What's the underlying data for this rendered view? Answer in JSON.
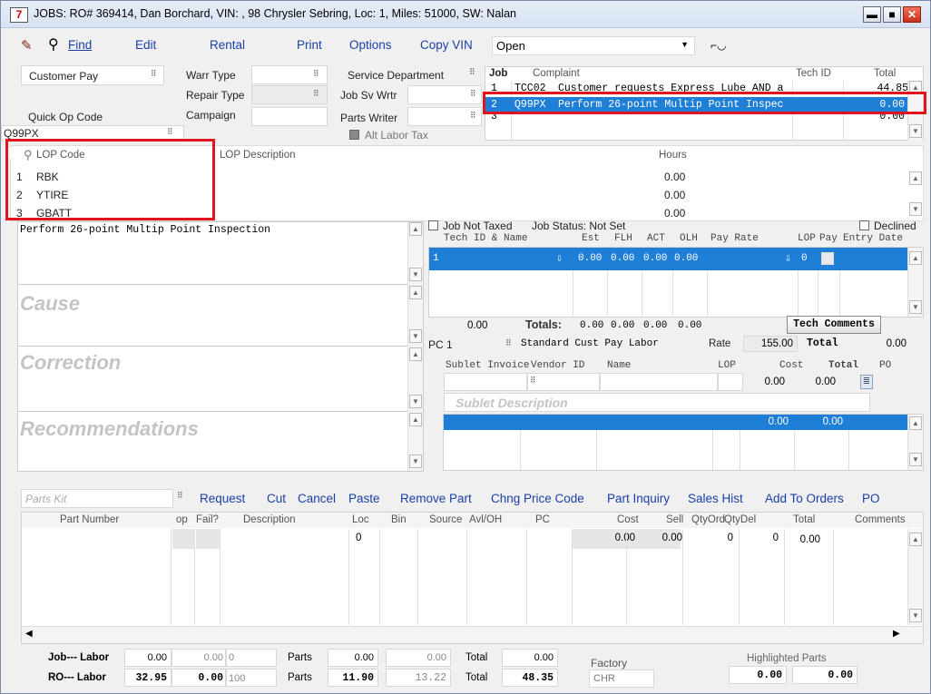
{
  "window": {
    "title": "JOBS: RO# 369414, Dan Borchard, VIN: , 98 Chrysler Sebring, Loc: 1, Miles: 51000, SW: Nalan",
    "icon_label": "7",
    "min": "▬",
    "max": "■",
    "close": "✕"
  },
  "toolbar": {
    "find": "Find",
    "edit": "Edit",
    "rental": "Rental",
    "print": "Print",
    "options": "Options",
    "copy_vin": "Copy VIN",
    "status_value": "Open"
  },
  "header": {
    "pay_type": "Customer Pay",
    "warr_type": "Warr Type",
    "repair_type": "Repair Type",
    "campaign": "Campaign",
    "service_department": "Service Department",
    "job_sv_wrtr": "Job Sv Wrtr",
    "parts_writer": "Parts Writer",
    "alt_labor_tax": "Alt Labor Tax",
    "quick_op_code_label": "Quick Op Code",
    "quick_op_code_value": "Q99PX"
  },
  "jobs": {
    "col_job": "Job",
    "col_complaint": "Complaint",
    "col_tech": "Tech ID",
    "col_total": "Total",
    "rows": [
      {
        "num": "1",
        "code": "TCC02",
        "complaint": "Customer requests Express Lube AND a",
        "total": "44.85"
      },
      {
        "num": "2",
        "code": "Q99PX",
        "complaint": "Perform 26-point Multip Point Inspec",
        "total": "0.00"
      },
      {
        "num": "3",
        "code": "",
        "complaint": "",
        "total": "0.00"
      }
    ]
  },
  "lop": {
    "col_code": "LOP Code",
    "col_desc": "LOP Description",
    "col_hours": "Hours",
    "rows": [
      {
        "num": "1",
        "code": "RBK",
        "hours": "0.00"
      },
      {
        "num": "2",
        "code": "YTIRE",
        "hours": "0.00"
      },
      {
        "num": "3",
        "code": "GBATT",
        "hours": "0.00"
      }
    ]
  },
  "story": {
    "complaint_text": "Perform 26-point Multip Point Inspection",
    "cause": "Cause",
    "correction": "Correction",
    "recommendations": "Recommendations"
  },
  "tech": {
    "job_not_taxed": "Job Not Taxed",
    "job_status": "Job Status: Not Set",
    "declined": "Declined",
    "col_tech": "Tech ID & Name",
    "col_est": "Est",
    "col_flh": "FLH",
    "col_act": "ACT",
    "col_olh": "OLH",
    "col_payrate": "Pay Rate",
    "col_lop": "LOP",
    "col_pay": "Pay",
    "col_entry": "Entry Date",
    "row": {
      "num": "1",
      "est": "0.00",
      "flh": "0.00",
      "act": "0.00",
      "olh": "0.00",
      "lop": "0"
    },
    "totals_left": "0.00",
    "totals_label": "Totals:",
    "t_est": "0.00",
    "t_flh": "0.00",
    "t_act": "0.00",
    "t_olh": "0.00",
    "tech_comments": "Tech Comments",
    "pc_label": "PC 1",
    "pc_desc": "Standard Cust Pay Labor",
    "rate_label": "Rate",
    "rate_value": "155.00",
    "total_label": "Total",
    "total_value": "0.00"
  },
  "sublet": {
    "col_invoice": "Sublet Invoice",
    "col_vendor": "Vendor ID",
    "col_name": "Name",
    "col_lop": "LOP",
    "col_cost": "Cost",
    "col_total": "Total",
    "col_po": "PO",
    "cost": "0.00",
    "total": "0.00",
    "description": "Sublet Description",
    "row_cost": "0.00",
    "row_total": "0.00"
  },
  "parts": {
    "kit_placeholder": "Parts Kit",
    "actions": [
      "Request",
      "Cut",
      "Cancel",
      "Paste",
      "Remove Part",
      "Chng Price Code",
      "Part Inquiry",
      "Sales Hist",
      "Add To Orders",
      "PO"
    ],
    "cols": {
      "part_number": "Part Number",
      "op": "op",
      "fail": "Fail?",
      "description": "Description",
      "loc": "Loc",
      "bin": "Bin",
      "source": "Source",
      "avl": "Avl/OH",
      "pc": "PC",
      "cost": "Cost",
      "sell": "Sell",
      "qtyord": "QtyOrd",
      "qtydel": "QtyDel",
      "total": "Total",
      "comments": "Comments"
    },
    "row": {
      "loc": "0",
      "cost": "0.00",
      "sell": "0.00",
      "qtyord": "0",
      "qtydel": "0",
      "total": "0.00"
    }
  },
  "footer": {
    "job_label": "Job--- Labor",
    "job_labor": "0.00",
    "job_labor2": "0.00",
    "job_labor3": "0",
    "job_parts_label": "Parts",
    "job_parts": "0.00",
    "job_parts2": "0.00",
    "job_total_label": "Total",
    "job_total": "0.00",
    "ro_label": "RO--- Labor",
    "ro_labor": "32.95",
    "ro_labor2": "0.00",
    "ro_labor3": "100",
    "ro_parts_label": "Parts",
    "ro_parts": "11.90",
    "ro_parts2": "13.22",
    "ro_total_label": "Total",
    "ro_total": "48.35",
    "factory_label": "Factory",
    "factory_value": "CHR",
    "highlighted_label": "Highlighted Parts",
    "hp1": "0.00",
    "hp2": "0.00"
  }
}
